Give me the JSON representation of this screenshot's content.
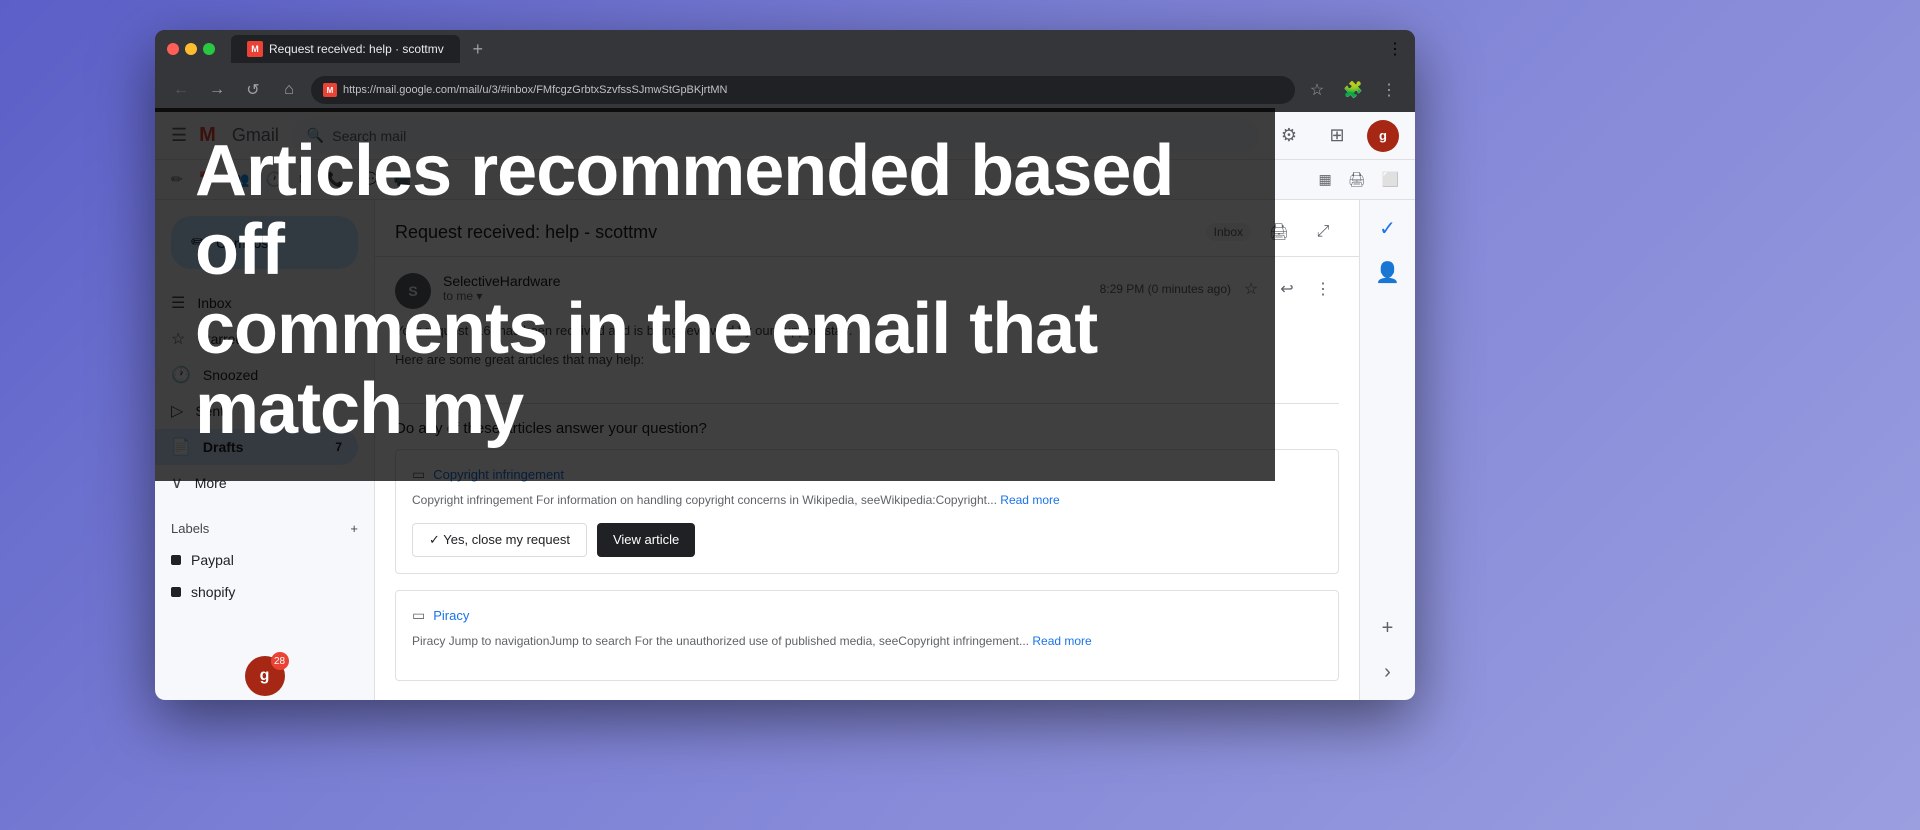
{
  "background": {
    "gradient_start": "#5b5fc7",
    "gradient_end": "#9b9fe0"
  },
  "browser": {
    "tab_title": "Request received: help · scottmv",
    "url": "https://mail.google.com/mail/u/3/#inbox/FMfcgzGrbtxSzvfssSJmwStGpBKjrtMN",
    "tab_plus": "+",
    "nav_back": "←",
    "nav_forward": "→",
    "nav_refresh": "↺",
    "nav_home": "⌂",
    "star_icon": "☆",
    "extensions_icon": "🧩",
    "menu_icon": "⋮"
  },
  "gmail": {
    "hamburger": "☰",
    "logo": "Gmail",
    "search_placeholder": "Search mail",
    "topbar_icons": [
      "⚙",
      "⊞",
      "●"
    ],
    "compose_label": "Compose",
    "nav_items": [
      {
        "id": "inbox",
        "label": "Inbox",
        "icon": "📥",
        "count": null,
        "active": false
      },
      {
        "id": "starred",
        "label": "Starred",
        "icon": "☆",
        "count": null,
        "active": false
      },
      {
        "id": "snoozed",
        "label": "Snoozed",
        "icon": "🕐",
        "count": null,
        "active": false
      },
      {
        "id": "sent",
        "label": "Sent",
        "icon": "▷",
        "count": null,
        "active": false
      },
      {
        "id": "drafts",
        "label": "Drafts",
        "icon": "📄",
        "count": "7",
        "active": true
      },
      {
        "id": "more",
        "label": "More",
        "icon": "∨",
        "count": null,
        "active": false
      }
    ],
    "labels_header": "Labels",
    "labels_add": "+",
    "labels": [
      {
        "id": "paypal",
        "label": "Paypal"
      },
      {
        "id": "shopify",
        "label": "shopify"
      }
    ],
    "user_avatar": "g",
    "user_badge": "28"
  },
  "email": {
    "subject": "Request received: help - scottmv",
    "sender": "SelectiveHardware",
    "sender_initial": "S",
    "recipient": "to me",
    "time": "8:29 PM (0 minutes ago)",
    "body_line1": "Your request (16) has been received and is being reviewed by our support staff.",
    "body_line2": "Here are some great articles that may help:",
    "articles_question": "Do any of these articles answer your question?",
    "articles": [
      {
        "id": "copyright",
        "title": "Copyright infringement",
        "description": "Copyright infringement For information on handling copyright concerns in Wikipedia, seeWikipedia:Copyright...",
        "read_more": "Read more",
        "btn_yes": "✓ Yes, close my request",
        "btn_view": "View article"
      },
      {
        "id": "piracy",
        "title": "Piracy",
        "description": "Piracy Jump to navigationJump to search For the unauthorized use of published media, seeCopyright infringement...",
        "read_more": "Read more"
      }
    ]
  },
  "overlay": {
    "heading_line1": "Articles recommended based off",
    "heading_line2": "comments in the email that match my"
  },
  "right_panel": {
    "icons": [
      "✓",
      "👤",
      "+",
      "›"
    ]
  }
}
